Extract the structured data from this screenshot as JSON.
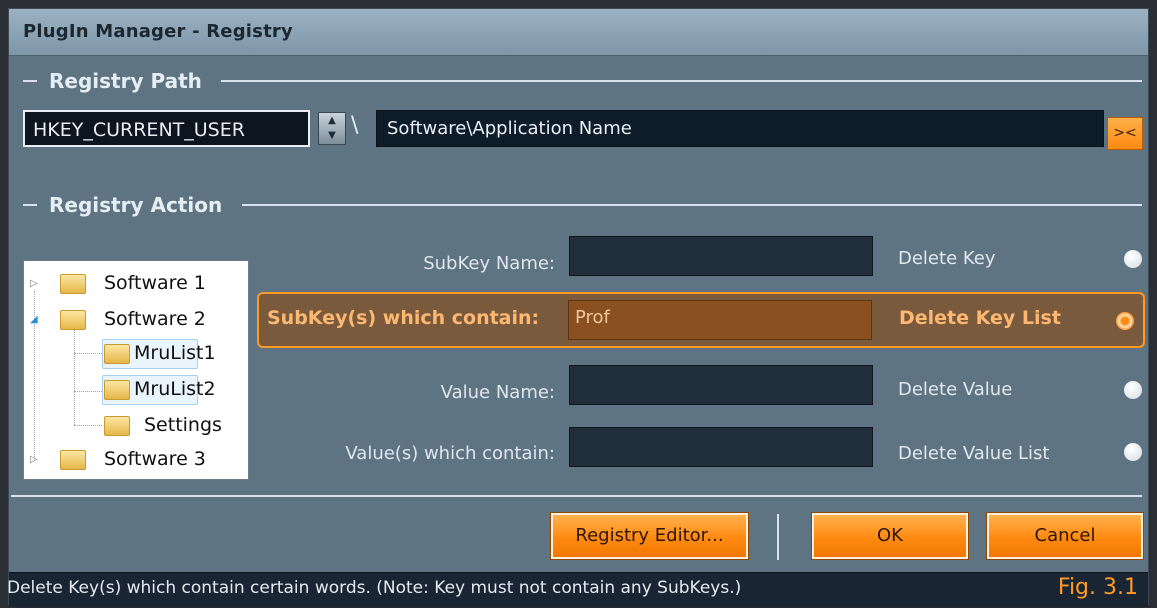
{
  "window": {
    "title": "PlugIn Manager - Registry"
  },
  "registry_path": {
    "section_label": "Registry Path",
    "hive": "HKEY_CURRENT_USER",
    "separator": "\\",
    "path": "Software\\Application Name",
    "swap_label": "><"
  },
  "registry_action": {
    "section_label": "Registry Action",
    "tree": [
      {
        "label": "Software 1"
      },
      {
        "label": "Software 2"
      },
      {
        "label": "MruList1"
      },
      {
        "label": "MruList2"
      },
      {
        "label": "Settings"
      },
      {
        "label": "Software 3"
      }
    ],
    "rows": [
      {
        "label": "SubKey Name:",
        "value": "",
        "action": "Delete Key",
        "selected": false
      },
      {
        "label": "SubKey(s) which contain:",
        "value": "Prof",
        "action": "Delete Key List",
        "selected": true
      },
      {
        "label": "Value Name:",
        "value": "",
        "action": "Delete Value",
        "selected": false
      },
      {
        "label": "Value(s) which contain:",
        "value": "",
        "action": "Delete Value List",
        "selected": false
      }
    ]
  },
  "buttons": {
    "registry_editor": "Registry Editor...",
    "ok": "OK",
    "cancel": "Cancel"
  },
  "status": {
    "message": "Delete Key(s) which contain certain words.  (Note: Key must not contain any SubKeys.)",
    "figure": "Fig. 3.1"
  },
  "colors": {
    "accent": "#ff8a12",
    "background": "#5f7483"
  }
}
